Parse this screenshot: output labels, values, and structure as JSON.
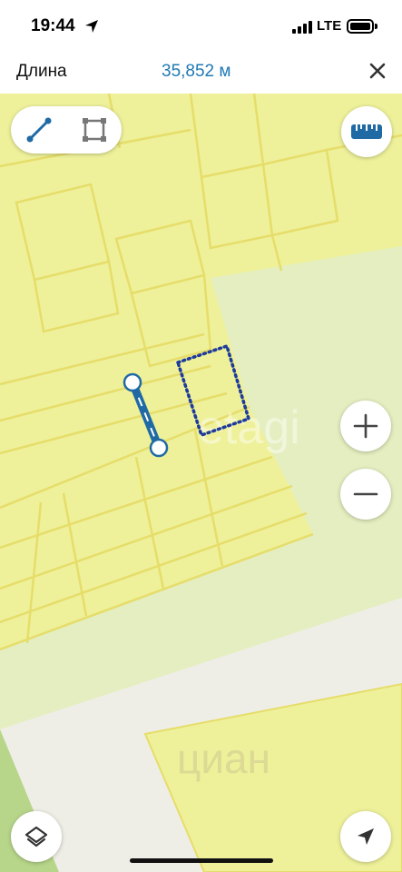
{
  "status_bar": {
    "time": "19:44",
    "network": "LTE",
    "location_icon": "location-arrow-icon",
    "signal_icon": "cellular-signal-icon",
    "battery_icon": "battery-icon"
  },
  "header": {
    "title": "Длина",
    "measurement": "35,852 м",
    "close_icon": "close-icon"
  },
  "map": {
    "watermark": "etagi",
    "watermark_bottom": "циан",
    "colors": {
      "parcel_fill": "#eef19a",
      "parcel_border": "#e6dd6a",
      "green_area": "#e4eec0",
      "road": "#efeee6",
      "measure_line": "#1f6aa5",
      "dotted_polygon": "#1e3a9c"
    },
    "measure_tool": {
      "line_mode_icon": "measure-line-icon",
      "polygon_mode_icon": "measure-polygon-icon",
      "active_mode": "line"
    },
    "controls": {
      "ruler_icon": "ruler-icon",
      "zoom_in_icon": "plus-icon",
      "zoom_out_icon": "minus-icon",
      "layers_icon": "layers-icon",
      "navigate_icon": "navigation-arrow-icon"
    }
  }
}
